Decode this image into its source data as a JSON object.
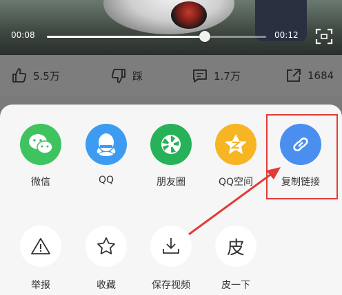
{
  "player": {
    "current_time": "00:08",
    "duration": "00:12",
    "progress": 0.72
  },
  "actions": {
    "like_count": "5.5万",
    "dislike_label": "踩",
    "comment_count": "1.7万",
    "share_count": "1684"
  },
  "share_sheet": {
    "row1": [
      {
        "label": "微信",
        "icon": "wechat-icon",
        "color": "#3fc35f"
      },
      {
        "label": "QQ",
        "icon": "qq-icon",
        "color": "#3d9cf2"
      },
      {
        "label": "朋友圈",
        "icon": "moments-icon",
        "color": "#27b25a"
      },
      {
        "label": "QQ空间",
        "icon": "qzone-icon",
        "color": "#f7b523"
      },
      {
        "label": "复制链接",
        "icon": "link-icon",
        "color": "#4a8ef0"
      }
    ],
    "row2": [
      {
        "label": "举报",
        "icon": "warning-icon"
      },
      {
        "label": "收藏",
        "icon": "star-icon"
      },
      {
        "label": "保存视频",
        "icon": "download-icon"
      },
      {
        "label": "皮一下",
        "icon": "pi-icon",
        "glyph": "皮"
      }
    ]
  },
  "annotation_color": "#e23b35"
}
